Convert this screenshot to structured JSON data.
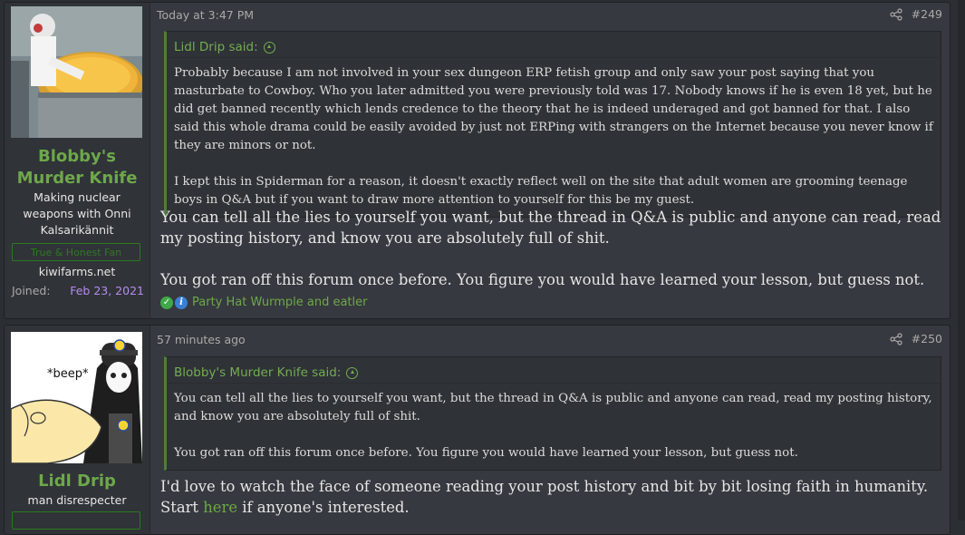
{
  "posts": [
    {
      "user": {
        "name": "Blobby's Murder Knife",
        "title": "Making nuclear weapons with Onni Kalsarikännit",
        "banner": "True & Honest Fan",
        "site": "kiwifarms.net",
        "joined_label": "Joined:",
        "joined_date": "Feb 23, 2021"
      },
      "time": "Today at 3:47 PM",
      "number": "#249",
      "quote": {
        "author": "Lidl Drip said:",
        "paragraphs": [
          "Probably because I am not involved in your sex dungeon ERP fetish group and only saw your post saying that you masturbate to Cowboy. Who you later admitted you were previously told was 17. Nobody knows if he is even 18 yet, but he did get banned recently which lends credence to the theory that he is indeed underaged and got banned for that. I also said this whole drama could be easily avoided by just not ERPing with strangers on the Internet because you never know if they are minors or not.",
          "I kept this in Spiderman for a reason, it doesn't exactly reflect well on the site that adult women are grooming teenage boys in Q&A but if you want to draw more attention to yourself for this be my guest."
        ]
      },
      "message": [
        "You can tell all the lies to yourself you want, but the thread in Q&A is public and anyone can read, read my posting history, and know you are absolutely full of shit.",
        "You got ran off this forum once before. You figure you would have learned your lesson, but guess not."
      ],
      "reactions": "Party Hat Wurmple and eatler"
    },
    {
      "user": {
        "name": "Lidl Drip",
        "title": "man disrespecter",
        "avatar_caption": "*beep*"
      },
      "time": "57 minutes ago",
      "number": "#250",
      "quote": {
        "author": "Blobby's Murder Knife said:",
        "paragraphs": [
          "You can tell all the lies to yourself you want, but the thread in Q&A is public and anyone can read, read my posting history, and know you are absolutely full of shit.",
          "You got ran off this forum once before. You figure you would have learned your lesson, but guess not."
        ]
      },
      "message": {
        "before_link": "I'd love to watch the face of someone reading your post history and bit by bit losing faith in humanity. Start ",
        "link": "here",
        "after_link": " if anyone's interested."
      }
    }
  ]
}
